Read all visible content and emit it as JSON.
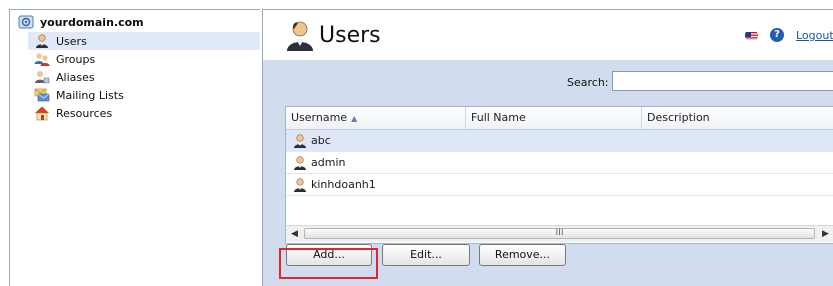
{
  "sidebar": {
    "domain": "yourdomain.com",
    "items": [
      {
        "label": "Users",
        "icon": "user-icon"
      },
      {
        "label": "Groups",
        "icon": "groups-icon"
      },
      {
        "label": "Aliases",
        "icon": "aliases-icon"
      },
      {
        "label": "Mailing Lists",
        "icon": "mailing-list-icon"
      },
      {
        "label": "Resources",
        "icon": "house-icon"
      }
    ]
  },
  "header": {
    "title": "Users",
    "logout": "Logout",
    "help": "?"
  },
  "search": {
    "label": "Search:",
    "value": ""
  },
  "grid": {
    "columns": [
      "Username",
      "Full Name",
      "Description"
    ],
    "rows": [
      {
        "username": "abc",
        "full_name": "",
        "description": ""
      },
      {
        "username": "admin",
        "full_name": "",
        "description": ""
      },
      {
        "username": "kinhdoanh1",
        "full_name": "",
        "description": ""
      }
    ],
    "scroll_grip": "III"
  },
  "buttons": {
    "add": "Add...",
    "edit": "Edit...",
    "remove": "Remove..."
  },
  "colors": {
    "highlight": "#e0262d",
    "panel_bg": "#d1ddef",
    "link": "#1a55a5"
  }
}
